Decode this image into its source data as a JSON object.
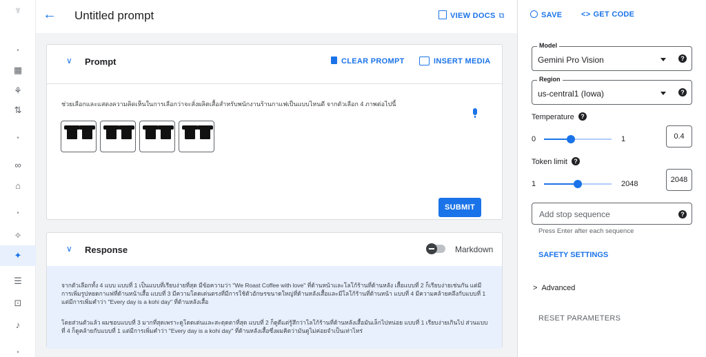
{
  "header": {
    "title": "Untitled prompt",
    "view_docs": "VIEW DOCS",
    "ext_glyph": "⧉"
  },
  "rail": {
    "icons": [
      "logo-icon",
      "dot-icon",
      "dashboard-icon",
      "model-garden-icon",
      "pipelines-icon",
      "dot-icon",
      "colab-icon",
      "workbench-icon",
      "dot-icon",
      "sparkle-icon",
      "sparkle-active-icon",
      "prompt-list-icon",
      "new-prompt-icon",
      "speech-icon",
      "dot-icon"
    ]
  },
  "prompt_card": {
    "title": "Prompt",
    "clear": "CLEAR PROMPT",
    "insert_media": "INSERT MEDIA",
    "text": "ช่วยเลือกและแสดงความคิดเห็นในการเลือกว่าจะสั่งผลิตเสื้อสำหรับพนักงานร้านกาแฟเป็นแบบไหนดี จากตัวเลือก 4 ภาพต่อไปนี้",
    "submit": "SUBMIT",
    "images": [
      "shirt-1",
      "shirt-2",
      "shirt-3",
      "shirt-4"
    ]
  },
  "response_card": {
    "title": "Response",
    "markdown_label": "Markdown",
    "markdown_on": false,
    "paragraph1": "จากตัวเลือกทั้ง 4 แบบ แบบที่ 1 เป็นแบบที่เรียบง่ายที่สุด มีข้อความว่า \"We Roast Coffee with love\" ที่ด้านหน้าและโลโก้ร้านที่ด้านหลัง เสื้อแบบที่ 2 ก็เรียบง่ายเช่นกัน แต่มีการเพิ่มรูปหยดกาแฟที่ด้านหน้าเสื้อ แบบที่ 3 มีความโดดเด่นตรงที่มีการใช้ตัวอักษรขนาดใหญ่ที่ด้านหลังเสื้อและมีโลโก้ร้านที่ด้านหน้า แบบที่ 4 มีความคล้ายคลึงกับแบบที่ 1 แต่มีการเพิ่มคำว่า \"Every day is a kohi day\" ที่ด้านหลังเสื้อ",
    "paragraph2": "โดยส่วนตัวแล้ว ผมชอบแบบที่ 3 มากที่สุดเพราะดูโดดเด่นและสะดุดตาที่สุด แบบที่ 2 ก็ดูดีแต่รู้สึกว่าโลโก้ร้านที่ด้านหลังเสื้อมันเล็กไปหน่อย แบบที่ 1 เรียบง่ายเกินไป ส่วนแบบที่ 4 ก็ดูคล้ายกับแบบที่ 1 แต่มีการเพิ่มคำว่า \"Every day is a kohi day\" ที่ด้านหลังเสื้อซึ่งผมคิดว่ามันดูไม่ค่อยจำเป็นเท่าไหร่"
  },
  "panel": {
    "save": "SAVE",
    "get_code": "GET CODE",
    "code_glyph": "<>",
    "model_label": "Model",
    "model_value": "Gemini Pro Vision",
    "region_label": "Region",
    "region_value": "us-central1 (Iowa)",
    "temperature_label": "Temperature",
    "temp_min": "0",
    "temp_max": "1",
    "temp_value": "0.4",
    "temp_fraction": 0.4,
    "token_label": "Token limit",
    "token_min": "1",
    "token_max": "2048",
    "token_value": "2048",
    "token_fraction": 0.5,
    "stop_placeholder": "Add stop sequence",
    "stop_hint": "Press Enter after each sequence",
    "safety": "SAFETY SETTINGS",
    "advanced": "Advanced",
    "advanced_glyph": ">",
    "reset": "RESET PARAMETERS"
  },
  "colors": {
    "accent": "#1a73e8",
    "response_bg": "#e8f0fe",
    "canvas_bg": "#f1f3f4"
  }
}
